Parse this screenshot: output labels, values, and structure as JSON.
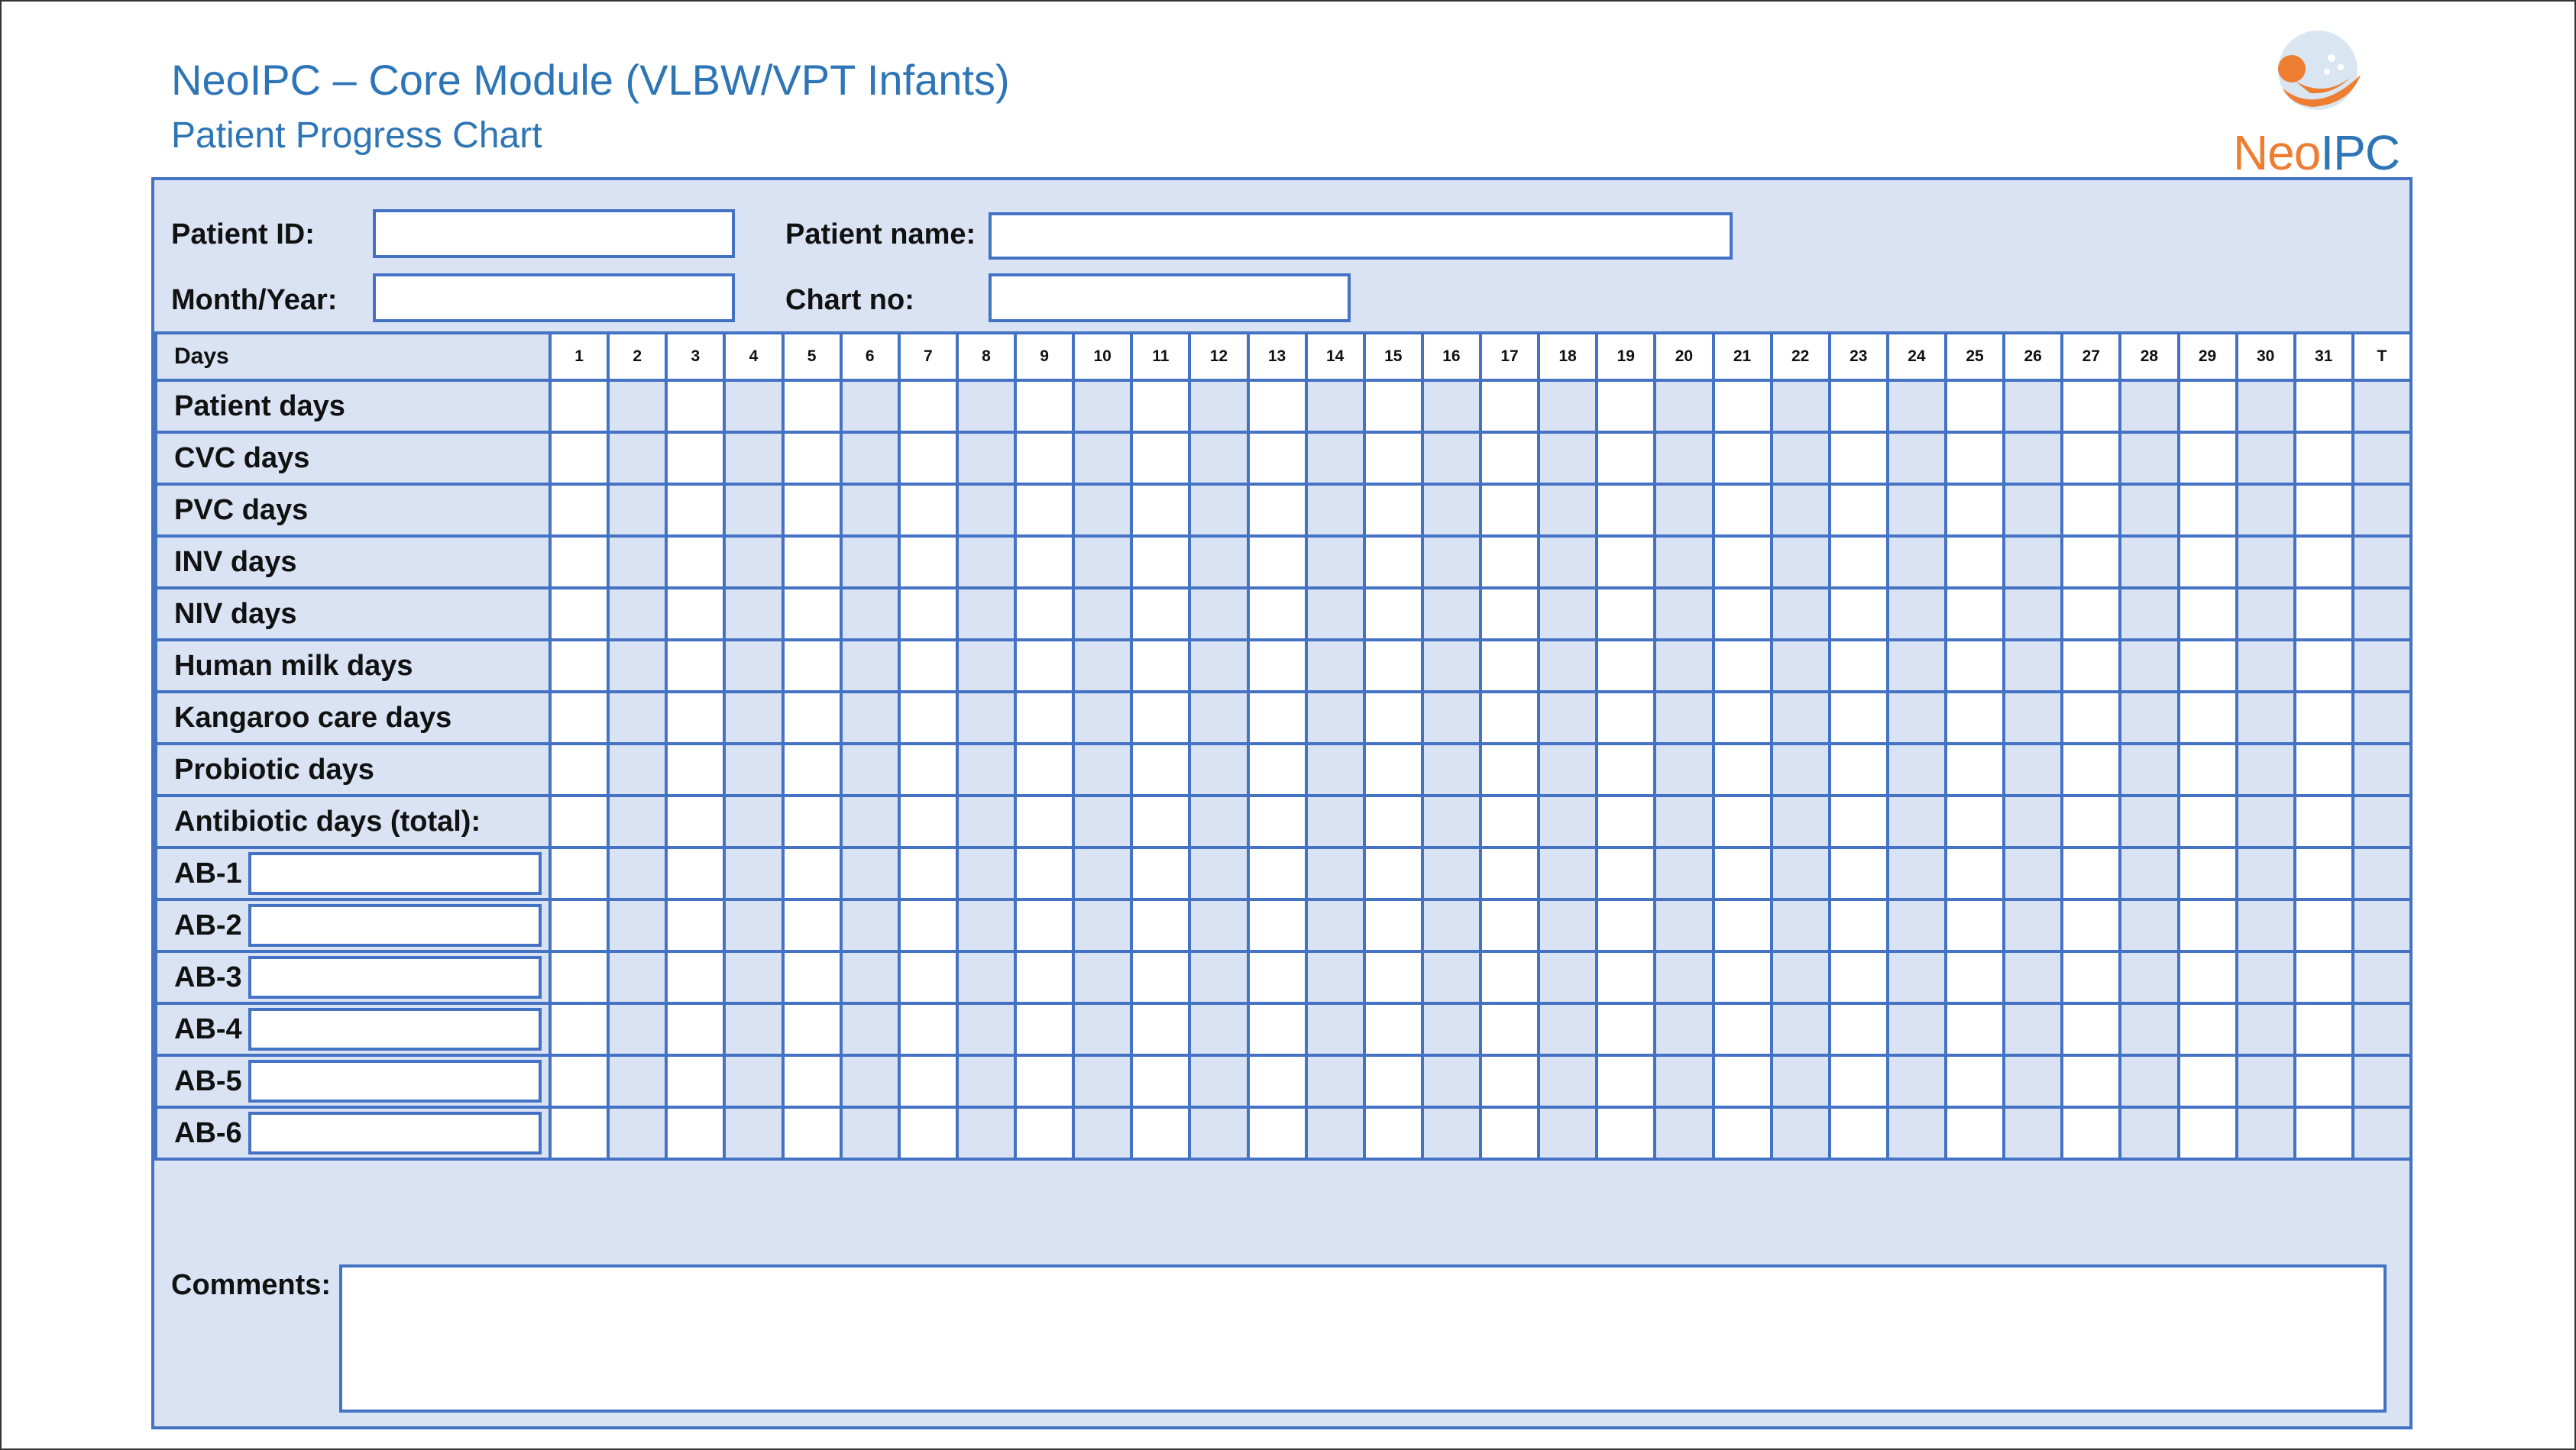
{
  "header": {
    "title": "NeoIPC – Core Module (VLBW/VPT Infants)",
    "subtitle": "Patient Progress Chart"
  },
  "logo": {
    "text_neo": "Neo",
    "text_ipc": "IPC",
    "colors": {
      "orange": "#ed7d31",
      "blue": "#2e75b6"
    }
  },
  "fields": {
    "patient_id": {
      "label": "Patient ID:",
      "value": ""
    },
    "patient_name": {
      "label": "Patient name:",
      "value": ""
    },
    "month_year": {
      "label": "Month/Year:",
      "value": ""
    },
    "chart_no": {
      "label": "Chart no:",
      "value": ""
    }
  },
  "grid": {
    "days_label": "Days",
    "day_headers": [
      "1",
      "2",
      "3",
      "4",
      "5",
      "6",
      "7",
      "8",
      "9",
      "10",
      "11",
      "12",
      "13",
      "14",
      "15",
      "16",
      "17",
      "18",
      "19",
      "20",
      "21",
      "22",
      "23",
      "24",
      "25",
      "26",
      "27",
      "28",
      "29",
      "30",
      "31",
      "T"
    ],
    "rows": [
      "Patient days",
      "CVC days",
      "PVC days",
      "INV days",
      "NIV days",
      "Human milk days",
      "Kangaroo care days",
      "Probiotic days",
      "Antibiotic days (total):"
    ],
    "ab_rows": [
      "AB-1",
      "AB-2",
      "AB-3",
      "AB-4",
      "AB-5",
      "AB-6"
    ]
  },
  "comments": {
    "label": "Comments:",
    "value": ""
  },
  "colors": {
    "title_blue": "#2e75b6",
    "border_blue": "#4472c4",
    "panel_fill": "#dae3f3"
  }
}
